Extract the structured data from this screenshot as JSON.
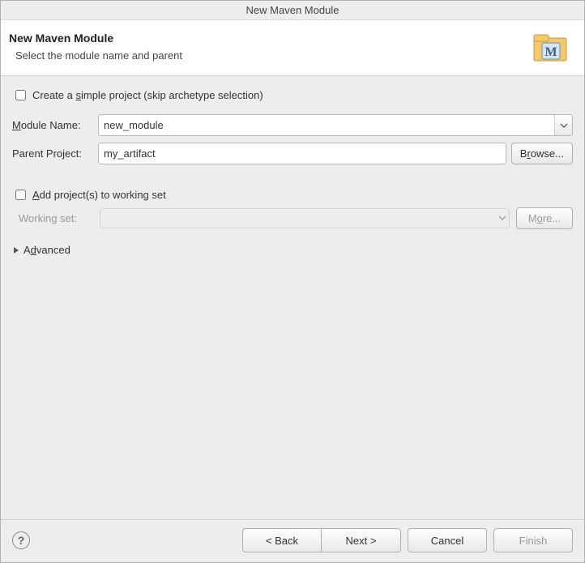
{
  "window": {
    "title": "New Maven Module"
  },
  "header": {
    "title": "New Maven Module",
    "subtitle": "Select the module name and parent"
  },
  "form": {
    "simple_project_label": "Create a simple project (skip archetype selection)",
    "simple_project_checked": false,
    "module_name_label": "Module Name:",
    "module_name_value": "new_module",
    "parent_project_label": "Parent Project:",
    "parent_project_value": "my_artifact",
    "browse_label": "Browse...",
    "add_to_working_set_label": "Add project(s) to working set",
    "add_to_working_set_checked": false,
    "working_set_label": "Working set:",
    "more_label": "More...",
    "advanced_label": "Advanced"
  },
  "footer": {
    "back_label": "< Back",
    "next_label": "Next >",
    "cancel_label": "Cancel",
    "finish_label": "Finish"
  }
}
